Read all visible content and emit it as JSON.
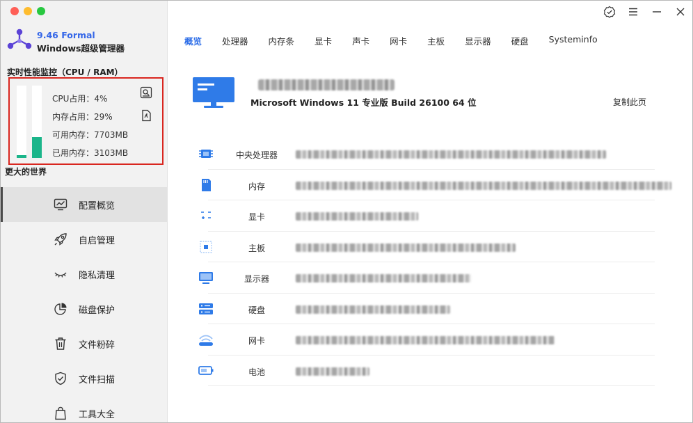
{
  "brand": {
    "version": "9.46 Formal",
    "name": "Windows超级管理器"
  },
  "monitor": {
    "title": "实时性能监控（CPU / RAM）",
    "cpu_percent": 4,
    "ram_percent": 29,
    "cpu_text": "CPU占用：4%",
    "ram_text": "内存占用：29%",
    "available_text": "可用内存：7703MB",
    "used_text": "已用内存：3103MB",
    "bar_color": "#1bb58a"
  },
  "slogan": "更大的世界",
  "nav": [
    {
      "label": "配置概览",
      "icon": "monitor-chart-icon",
      "active": true
    },
    {
      "label": "自启管理",
      "icon": "rocket-icon",
      "active": false
    },
    {
      "label": "隐私清理",
      "icon": "eye-closed-icon",
      "active": false
    },
    {
      "label": "磁盘保护",
      "icon": "pie-chart-icon",
      "active": false
    },
    {
      "label": "文件粉碎",
      "icon": "trash-icon",
      "active": false
    },
    {
      "label": "文件扫描",
      "icon": "shield-check-icon",
      "active": false
    },
    {
      "label": "工具大全",
      "icon": "shopping-bag-icon",
      "active": false
    }
  ],
  "tabs": [
    "概览",
    "处理器",
    "内存条",
    "显卡",
    "声卡",
    "网卡",
    "主板",
    "显示器",
    "硬盘",
    "Systeminfo"
  ],
  "active_tab": "概览",
  "header": {
    "computer_name": "",
    "os": "Microsoft Windows 11 专业版 Build 26100 64 位",
    "copy_label": "复制此页"
  },
  "rows": [
    {
      "label": "中央处理器",
      "icon": "cpu-chip-icon"
    },
    {
      "label": "内存",
      "icon": "sd-card-icon"
    },
    {
      "label": "显卡",
      "icon": "gpu-icon"
    },
    {
      "label": "主板",
      "icon": "motherboard-icon"
    },
    {
      "label": "显示器",
      "icon": "display-icon"
    },
    {
      "label": "硬盘",
      "icon": "hard-disk-icon"
    },
    {
      "label": "网卡",
      "icon": "wifi-icon"
    },
    {
      "label": "电池",
      "icon": "battery-icon"
    }
  ],
  "colors": {
    "accent": "#2f6fe8",
    "highlight_border": "#d9261f",
    "icon_blue": "#2f7be8"
  }
}
